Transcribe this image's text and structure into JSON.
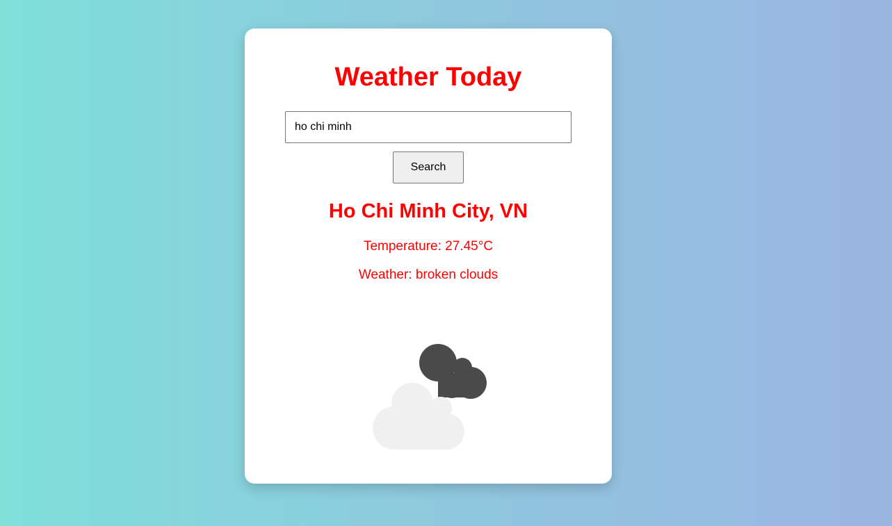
{
  "app": {
    "title": "Weather Today"
  },
  "search": {
    "value": "ho chi minh",
    "button_label": "Search"
  },
  "result": {
    "location": "Ho Chi Minh City, VN",
    "temperature_text": "Temperature: 27.45°C",
    "weather_text": "Weather: broken clouds",
    "icon": "broken-clouds-icon"
  },
  "colors": {
    "accent_text": "#ff0000",
    "background_gradient": [
      "#7fe0da",
      "#9bb5e3"
    ],
    "card": "#ffffff",
    "cloud_dark": "#4a4a4a",
    "cloud_light": "#f0f0f0"
  }
}
